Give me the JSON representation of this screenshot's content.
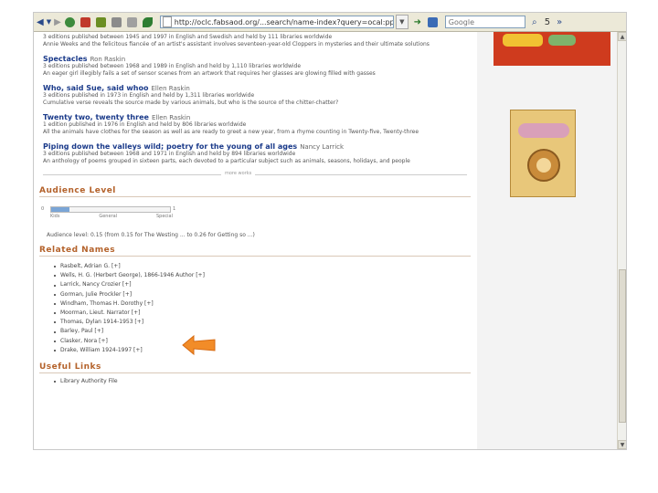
{
  "toolbar": {
    "url": "http://oclc.fabsaod.org/...search/name-index?query=ocal:ppey...se:=t=ad?...",
    "search_placeholder": "Google",
    "right_text": "5"
  },
  "results": [
    {
      "title": "",
      "author": "",
      "lines": [
        "3 editions published between 1945 and 1997 in English and Swedish and held by 111 libraries worldwide",
        "Annie Weeks and the felicitous fiancée of an artist's assistant involves seventeen-year-old Cloppers in mysteries and their ultimate solutions"
      ]
    },
    {
      "title": "Spectacles",
      "author": "Ron Raskin",
      "lines": [
        "3 editions published between 1968 and 1989 in English and held by 1,110 libraries worldwide",
        "An eager girl illegibly fails a set of sensor scenes from an artwork that requires her glasses are glowing filled with gasses"
      ]
    },
    {
      "title": "Who, said Sue, said whoo",
      "author": "Ellen Raskin",
      "lines": [
        "3 editions published in 1973 in English and held by 1,311 libraries worldwide",
        "Cumulative verse reveals the source made by various animals, but who is the source of the chitter-chatter?"
      ]
    },
    {
      "title": "Twenty two, twenty three",
      "author": "Ellen Raskin",
      "lines": [
        "1 edition published in 1976 in English and held by 806 libraries worldwide",
        "All the animals have clothes for the season as well as are ready to greet a new year, from a rhyme counting in Twenty-five, Twenty-three"
      ]
    },
    {
      "title": "Piping down the valleys wild; poetry for the young of all ages",
      "author": "Nancy Larrick",
      "lines": [
        "3 editions published between 1968 and 1971 in English and held by 894 libraries worldwide",
        "An anthology of poems grouped in sixteen parts, each devoted to a particular subject such as animals, seasons, holidays, and people"
      ]
    }
  ],
  "more_label": "more works",
  "audience": {
    "heading": "Audience Level",
    "start": "0",
    "end": "1",
    "fill": 0.15,
    "labels": [
      "Kids",
      "General",
      "Special"
    ],
    "note": "Audience level: 0.15 (from 0.15 for The Westing ... to 0.26 for Getting so ...)"
  },
  "related": {
    "heading": "Related Names",
    "items": [
      "Rasbelt, Adrian G. [+]",
      "Wells, H. G. (Herbert George), 1866-1946 Author [+]",
      "Larrick, Nancy Crozier [+]",
      "Gorman, Julie Prockler [+]",
      "Windham, Thomas H. Dorothy [+]",
      "Moorman, Lieut. Narrator [+]",
      "Thomas, Dylan 1914-1953 [+]",
      "Barley, Paul [+]",
      "Clasker, Nora [+]",
      "Drake, William 1924-1997 [+]"
    ]
  },
  "links": {
    "heading": "Useful Links",
    "items": [
      "Library Authority File"
    ]
  }
}
